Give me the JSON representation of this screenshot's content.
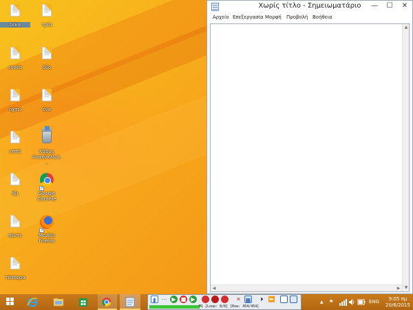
{
  "desktop": {
    "icons": [
      {
        "label": "δέκα",
        "type": "text-file",
        "selected": true
      },
      {
        "label": "τρία",
        "type": "text-file"
      },
      {
        "label": "εννέα",
        "type": "text-file"
      },
      {
        "label": "δύο",
        "type": "text-file"
      },
      {
        "label": "οχτώ",
        "type": "text-file"
      },
      {
        "label": "ένα",
        "type": "text-file"
      },
      {
        "label": "επτά",
        "type": "text-file"
      },
      {
        "label": "Κάδος Ανακύκλωσ...",
        "type": "recycle-bin"
      },
      {
        "label": "έξι",
        "type": "text-file"
      },
      {
        "label": "Google Chrome",
        "type": "chrome-shortcut"
      },
      {
        "label": "πέντε",
        "type": "text-file"
      },
      {
        "label": "Mozilla Firefox",
        "type": "firefox-shortcut"
      },
      {
        "label": "τέσσερα",
        "type": "text-file"
      }
    ]
  },
  "notepad": {
    "title": "Χωρίς τίτλο - Σημειωματάριο",
    "controls": {
      "minimize": "—",
      "maximize": "☐",
      "close": "✕"
    },
    "menu": [
      "Αρχείο",
      "Επεξεργασία",
      "Μορφή",
      "Προβολή",
      "Βοήθεια"
    ],
    "content": ""
  },
  "taskbar": {
    "pinned": [
      {
        "name": "Internet Explorer",
        "icon": "ie-icon"
      },
      {
        "name": "File Explorer",
        "icon": "folder-icon"
      },
      {
        "name": "Store",
        "icon": "store-icon"
      },
      {
        "name": "Google Chrome",
        "icon": "chrome-icon",
        "running": true
      },
      {
        "name": "Notepad",
        "icon": "notepad-icon",
        "running": true,
        "active": true
      }
    ]
  },
  "recorder": {
    "status": "M1 [Loop: 8/8] [Row: 454/454]",
    "progress": 0.33,
    "buttons": [
      "record-toggle",
      "play",
      "stop",
      "record",
      "pause-record",
      "delete",
      "settings",
      "next-step",
      "fast-forward",
      "window-a",
      "window-b"
    ]
  },
  "tray": {
    "language": "ENG",
    "time": "9:05 πμ",
    "date": "20/6/2015"
  },
  "colors": {
    "desktop": "#f7a51b",
    "taskbar": "#c0731a",
    "recorder_progress": "#3ec63a"
  }
}
